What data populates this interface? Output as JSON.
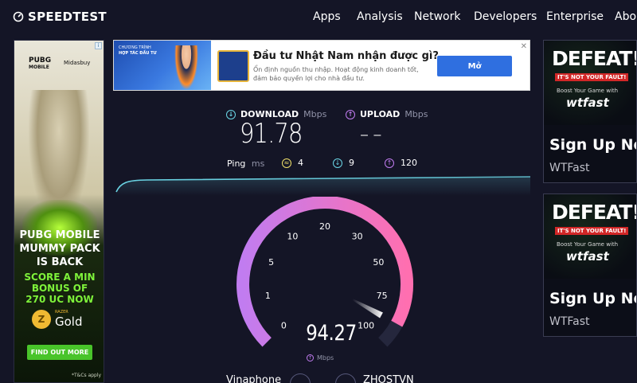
{
  "nav": {
    "logo_text": "SPEEDTEST",
    "items": [
      "Apps",
      "Analysis",
      "Network",
      "Developers",
      "Enterprise",
      "About"
    ]
  },
  "ad_left": {
    "brand": "PUBG",
    "brand_sub": "MOBILE",
    "partner": "Midasbuy",
    "title_lines": [
      "PUBG MOBILE",
      "MUMMY PACK",
      "IS BACK"
    ],
    "promo_lines": [
      "SCORE A MIN",
      "BONUS OF",
      "270 UC NOW"
    ],
    "gold_brand": "RAZER",
    "gold_label": "Gold",
    "cta": "FIND OUT MORE",
    "fine_print": "*T&Cs apply"
  },
  "ad_top": {
    "banner_lines": [
      "CHƯƠNG TRÌNH",
      "HỢP TÁC ĐẦU TƯ"
    ],
    "headline": "Đầu tư Nhật Nam nhận được gì?",
    "subtext": "Ổn định nguồn thu nhập. Hoạt động kinh doanh tốt, đảm bảo quyền lợi cho nhà đầu tư.",
    "button": "Mở"
  },
  "ad_right": [
    {
      "headline": "DEFEAT!",
      "badge": "IT'S NOT YOUR FAULT!",
      "tagline": "Boost Your Game with",
      "logo": "wtfast",
      "cta": "Sign Up Now",
      "brand": "WTFast"
    },
    {
      "headline": "DEFEAT!",
      "badge": "IT'S NOT YOUR FAULT!",
      "tagline": "Boost Your Game with",
      "logo": "wtfast",
      "cta": "Sign Up Now",
      "brand": "WTFast"
    }
  ],
  "results": {
    "download_label": "DOWNLOAD",
    "download_unit": "Mbps",
    "download_value": "91.78",
    "upload_label": "UPLOAD",
    "upload_unit": "Mbps",
    "upload_value": "– –",
    "ping_label": "Ping",
    "ping_unit": "ms",
    "ping_jitter": "4",
    "ping_download": "9",
    "ping_upload": "120"
  },
  "gauge": {
    "ticks": [
      "0",
      "1",
      "5",
      "10",
      "20",
      "30",
      "50",
      "75",
      "100"
    ],
    "current_value": "94.27",
    "unit": "Mbps",
    "needle_level": 0.94
  },
  "footer": {
    "isp": "Vinaphone",
    "server": "ZHOSTVN"
  },
  "colors": {
    "background": "#141526",
    "download_accent": "#6bd6e6",
    "upload_accent": "#c17cf0",
    "gauge_start": "#c17cf0",
    "gauge_end": "#ff6fb0"
  }
}
